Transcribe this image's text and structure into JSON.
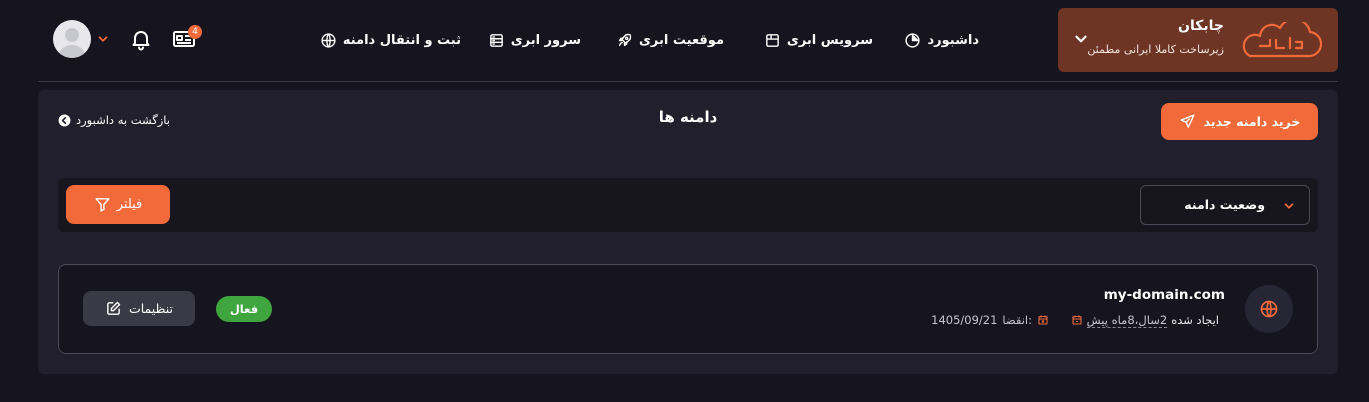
{
  "colors": {
    "accent": "#f26a3a",
    "brand_bg": "#6e3524",
    "page_bg": "#15141f",
    "panel_bg": "#211f2c",
    "active_green": "#3fa63f"
  },
  "brand": {
    "name": "چابکان",
    "slogan": "زیرساخت کاملا ایرانی مطمئن",
    "logo_icon": "cloud-logo-icon",
    "toggle_icon": "chevron-down-icon"
  },
  "nav": {
    "items": [
      {
        "label": "داشبورد",
        "icon": "pie-chart-icon"
      },
      {
        "label": "سرویس ابری",
        "icon": "box-icon"
      },
      {
        "label": "موقعیت ابری",
        "icon": "rocket-icon"
      },
      {
        "label": "سرور ابری",
        "icon": "server-icon"
      },
      {
        "label": "ثبت و انتقال دامنه",
        "icon": "globe-icon"
      }
    ]
  },
  "header_actions": {
    "news_badge": "4",
    "news_icon": "news-icon",
    "bell_icon": "bell-icon",
    "user_menu_icon": "chevron-down-icon",
    "avatar_icon": "user-avatar-icon"
  },
  "page": {
    "title": "دامنه ها",
    "buy_button": "خرید دامنه جدید",
    "buy_icon": "send-icon",
    "back_link": "بازگشت به داشبورد",
    "back_icon": "chevron-left-circle-icon"
  },
  "filters": {
    "status_select": "وضعیت دامنه",
    "status_icon": "chevron-down-icon",
    "filter_button": "فیلتر",
    "filter_icon": "filter-icon"
  },
  "domains": [
    {
      "name": "my-domain.com",
      "icon": "globe-icon",
      "created_label": "ایجاد شده",
      "created_ago": "2سال،8ماه پیش",
      "expire_label": "انقضا:",
      "expire_date": "1405/09/21",
      "status": "فعال",
      "settings_label": "تنظیمات",
      "settings_icon": "edit-icon"
    }
  ]
}
